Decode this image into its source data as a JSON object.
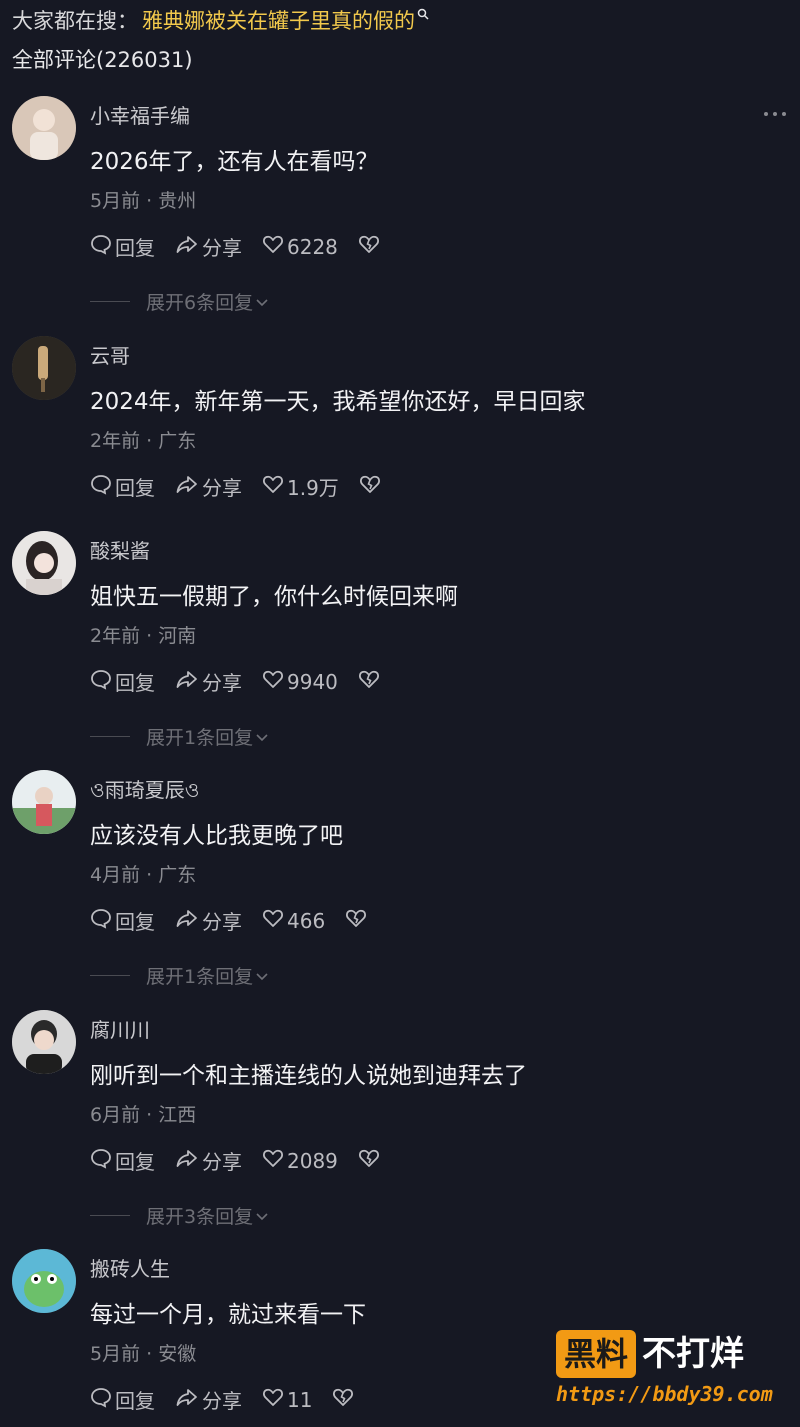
{
  "search": {
    "label": "大家都在搜：",
    "query": "雅典娜被关在罐子里真的假的",
    "icon": "search-icon"
  },
  "comments_header": "全部评论(226031)",
  "more_icon": "more-icon",
  "actions": {
    "reply": "回复",
    "share": "分享"
  },
  "comments": [
    {
      "username": "小幸福手编",
      "text": "2026年了，还有人在看吗？",
      "meta": "5月前 · 贵州",
      "likes": "6228",
      "expand": "展开6条回复"
    },
    {
      "username": "云哥",
      "text": "2024年，新年第一天，我希望你还好，早日回家",
      "meta": "2年前 · 广东",
      "likes": "1.9万",
      "expand": ""
    },
    {
      "username": "酸梨酱",
      "text": "姐快五一假期了，你什么时候回来啊",
      "meta": "2年前 · 河南",
      "likes": "9940",
      "expand": "展开1条回复"
    },
    {
      "username": "ও雨琦夏辰ও",
      "text": "应该没有人比我更晚了吧",
      "meta": "4月前 · 广东",
      "likes": "466",
      "expand": "展开1条回复"
    },
    {
      "username": "腐川川",
      "text": "刚听到一个和主播连线的人说她到迪拜去了",
      "meta": "6月前 · 江西",
      "likes": "2089",
      "expand": "展开3条回复"
    },
    {
      "username": "搬砖人生",
      "text": "每过一个月，就过来看一下",
      "meta": "5月前 · 安徽",
      "likes": "11",
      "expand": ""
    }
  ],
  "watermark": {
    "badge": "黑料",
    "text": "不打烊",
    "url": "https://bbdy39.com"
  },
  "colors": {
    "background": "#161823",
    "highlight": "#f2c94c",
    "watermark": "#f29a14"
  }
}
